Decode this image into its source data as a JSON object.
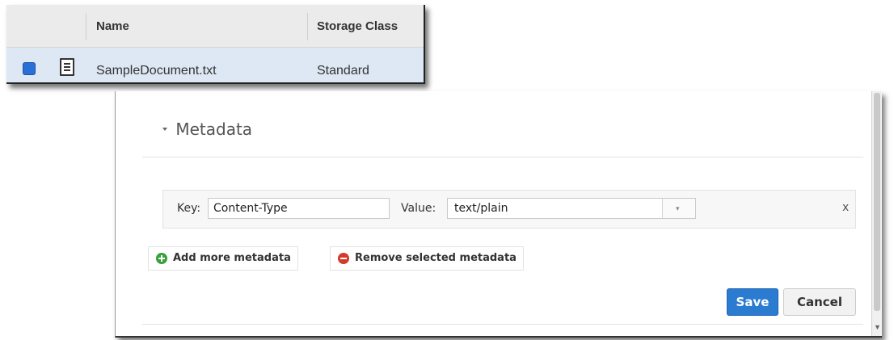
{
  "file_list": {
    "columns": [
      "Name",
      "Storage Class"
    ],
    "rows": [
      {
        "name": "SampleDocument.txt",
        "storage_class": "Standard",
        "selected": true
      }
    ],
    "icons": {
      "row_icon": "document-icon",
      "checkbox_color": "#2a6fd6"
    }
  },
  "metadata": {
    "section_title": "Metadata",
    "key_label": "Key:",
    "key_value": "Content-Type",
    "value_label": "Value:",
    "value_value": "text/plain",
    "dropdown_glyph": "▾",
    "remove_row_label": "x",
    "add_label": "Add more metadata",
    "remove_label": "Remove selected metadata",
    "save_label": "Save",
    "cancel_label": "Cancel",
    "colors": {
      "save_button": "#2b7bd1",
      "add_icon": "#38a13a",
      "remove_icon": "#d23b2c"
    }
  }
}
